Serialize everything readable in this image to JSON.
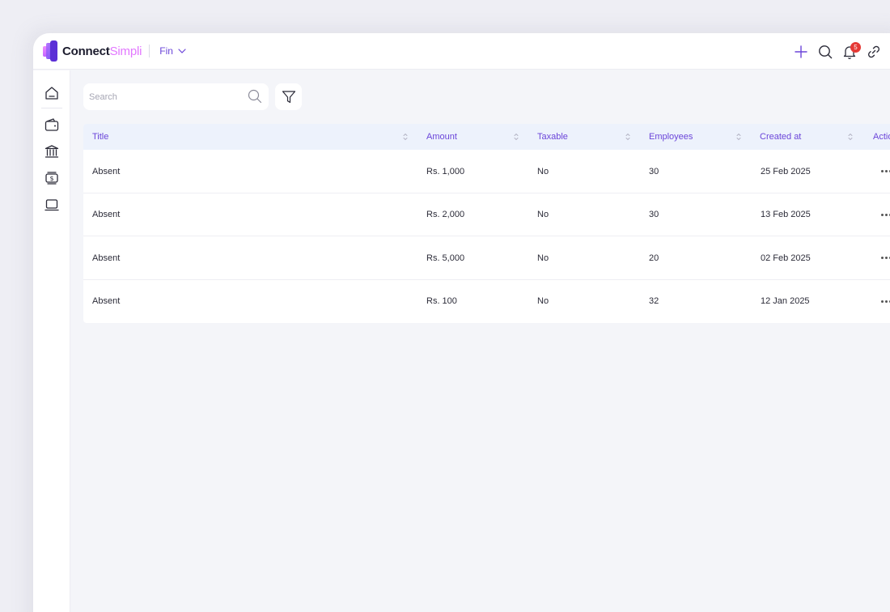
{
  "app": {
    "brand_primary": "Connect",
    "brand_accent": "Simpli",
    "org_name": "Fin",
    "notification_count": "5",
    "accent_color": "#6b45d9",
    "brand_accent_color": "#e277ff"
  },
  "topbar": {
    "icons": [
      "plus-icon",
      "search-icon",
      "bell-icon",
      "link-icon"
    ]
  },
  "sidebar": {
    "items": [
      {
        "icon": "home-icon"
      },
      {
        "icon": "wallet-icon"
      },
      {
        "icon": "bank-icon"
      },
      {
        "icon": "money-exchange-icon"
      },
      {
        "icon": "laptop-icon"
      }
    ]
  },
  "search": {
    "placeholder": "Search",
    "value": ""
  },
  "table": {
    "columns": [
      "Title",
      "Amount",
      "Taxable",
      "Employees",
      "Created at",
      "Actions"
    ],
    "rows": [
      {
        "title": "Absent",
        "amount": "Rs. 1,000",
        "taxable": "No",
        "employees": "30",
        "created_at": "25 Feb 2025"
      },
      {
        "title": "Absent",
        "amount": "Rs. 2,000",
        "taxable": "No",
        "employees": "30",
        "created_at": "13 Feb 2025"
      },
      {
        "title": "Absent",
        "amount": "Rs. 5,000",
        "taxable": "No",
        "employees": "20",
        "created_at": "02 Feb 2025"
      },
      {
        "title": "Absent",
        "amount": "Rs. 100",
        "taxable": "No",
        "employees": "32",
        "created_at": "12 Jan 2025"
      }
    ]
  }
}
